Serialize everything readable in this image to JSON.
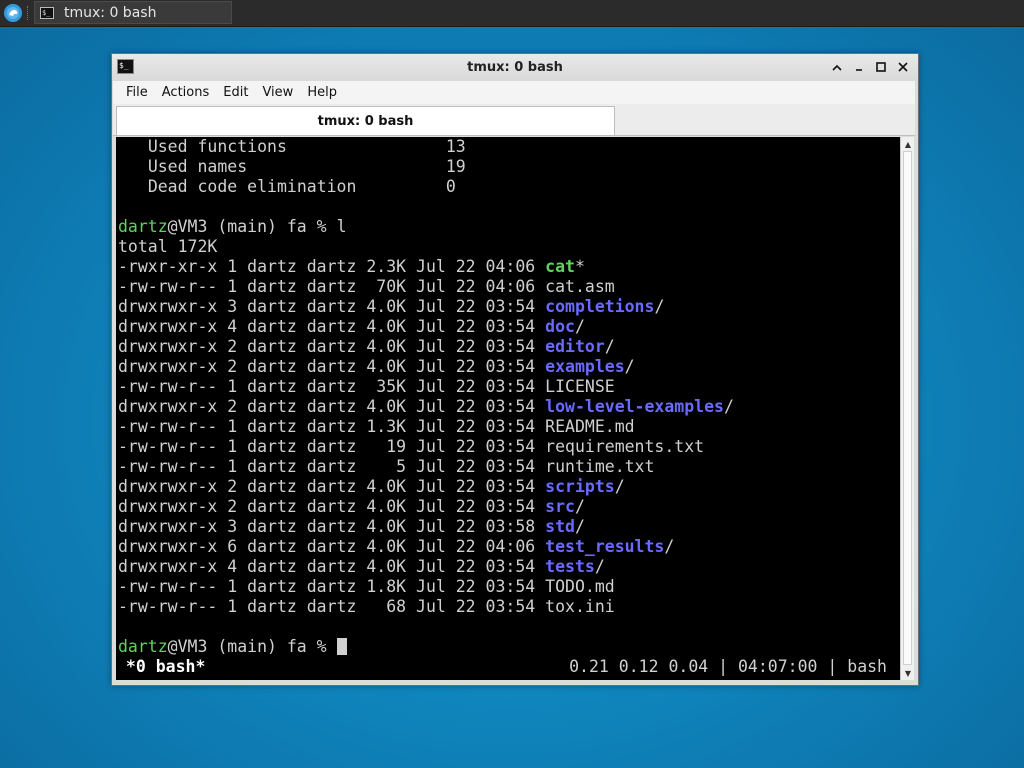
{
  "taskbar": {
    "start_icon": "xfce-logo-icon",
    "task_title": "tmux: 0 bash"
  },
  "window": {
    "title": "tmux: 0 bash",
    "menu": [
      "File",
      "Actions",
      "Edit",
      "View",
      "Help"
    ],
    "tab_title": "tmux: 0 bash",
    "controls": [
      "minimize-icon",
      "restore-icon",
      "maximize-icon",
      "close-icon"
    ]
  },
  "terminal": {
    "summary": [
      {
        "label": "Used functions",
        "value": "13"
      },
      {
        "label": "Used names",
        "value": "19"
      },
      {
        "label": "Dead code elimination",
        "value": "0"
      }
    ],
    "prompt": {
      "user": "dartz",
      "rest": "@VM3 (main) fa % ",
      "command": "l"
    },
    "total": "total 172K",
    "listing": [
      {
        "meta": "-rwxr-xr-x 1 dartz dartz 2.3K Jul 22 04:06 ",
        "name": "cat",
        "suffix": "*",
        "kind": "exec"
      },
      {
        "meta": "-rw-rw-r-- 1 dartz dartz  70K Jul 22 04:06 ",
        "name": "cat.asm",
        "suffix": "",
        "kind": "file"
      },
      {
        "meta": "drwxrwxr-x 3 dartz dartz 4.0K Jul 22 03:54 ",
        "name": "completions",
        "suffix": "/",
        "kind": "dir"
      },
      {
        "meta": "drwxrwxr-x 4 dartz dartz 4.0K Jul 22 03:54 ",
        "name": "doc",
        "suffix": "/",
        "kind": "dir"
      },
      {
        "meta": "drwxrwxr-x 2 dartz dartz 4.0K Jul 22 03:54 ",
        "name": "editor",
        "suffix": "/",
        "kind": "dir"
      },
      {
        "meta": "drwxrwxr-x 2 dartz dartz 4.0K Jul 22 03:54 ",
        "name": "examples",
        "suffix": "/",
        "kind": "dir"
      },
      {
        "meta": "-rw-rw-r-- 1 dartz dartz  35K Jul 22 03:54 ",
        "name": "LICENSE",
        "suffix": "",
        "kind": "file"
      },
      {
        "meta": "drwxrwxr-x 2 dartz dartz 4.0K Jul 22 03:54 ",
        "name": "low-level-examples",
        "suffix": "/",
        "kind": "dir"
      },
      {
        "meta": "-rw-rw-r-- 1 dartz dartz 1.3K Jul 22 03:54 ",
        "name": "README.md",
        "suffix": "",
        "kind": "file"
      },
      {
        "meta": "-rw-rw-r-- 1 dartz dartz   19 Jul 22 03:54 ",
        "name": "requirements.txt",
        "suffix": "",
        "kind": "file"
      },
      {
        "meta": "-rw-rw-r-- 1 dartz dartz    5 Jul 22 03:54 ",
        "name": "runtime.txt",
        "suffix": "",
        "kind": "file"
      },
      {
        "meta": "drwxrwxr-x 2 dartz dartz 4.0K Jul 22 03:54 ",
        "name": "scripts",
        "suffix": "/",
        "kind": "dir"
      },
      {
        "meta": "drwxrwxr-x 2 dartz dartz 4.0K Jul 22 03:54 ",
        "name": "src",
        "suffix": "/",
        "kind": "dir"
      },
      {
        "meta": "drwxrwxr-x 3 dartz dartz 4.0K Jul 22 03:58 ",
        "name": "std",
        "suffix": "/",
        "kind": "dir"
      },
      {
        "meta": "drwxrwxr-x 6 dartz dartz 4.0K Jul 22 04:06 ",
        "name": "test_results",
        "suffix": "/",
        "kind": "dir"
      },
      {
        "meta": "drwxrwxr-x 4 dartz dartz 4.0K Jul 22 03:54 ",
        "name": "tests",
        "suffix": "/",
        "kind": "dir"
      },
      {
        "meta": "-rw-rw-r-- 1 dartz dartz 1.8K Jul 22 03:54 ",
        "name": "TODO.md",
        "suffix": "",
        "kind": "file"
      },
      {
        "meta": "-rw-rw-r-- 1 dartz dartz   68 Jul 22 03:54 ",
        "name": "tox.ini",
        "suffix": "",
        "kind": "file"
      }
    ],
    "prompt2": {
      "user": "dartz",
      "rest": "@VM3 (main) fa % "
    },
    "status_left": " *0 bash*",
    "status_right": "0.21 0.12 0.04 | 04:07:00 | bash"
  },
  "colors": {
    "prompt_user": "#5fd35f",
    "directory": "#6a6aff",
    "executable": "#5fd35f",
    "terminal_bg": "#000000"
  }
}
